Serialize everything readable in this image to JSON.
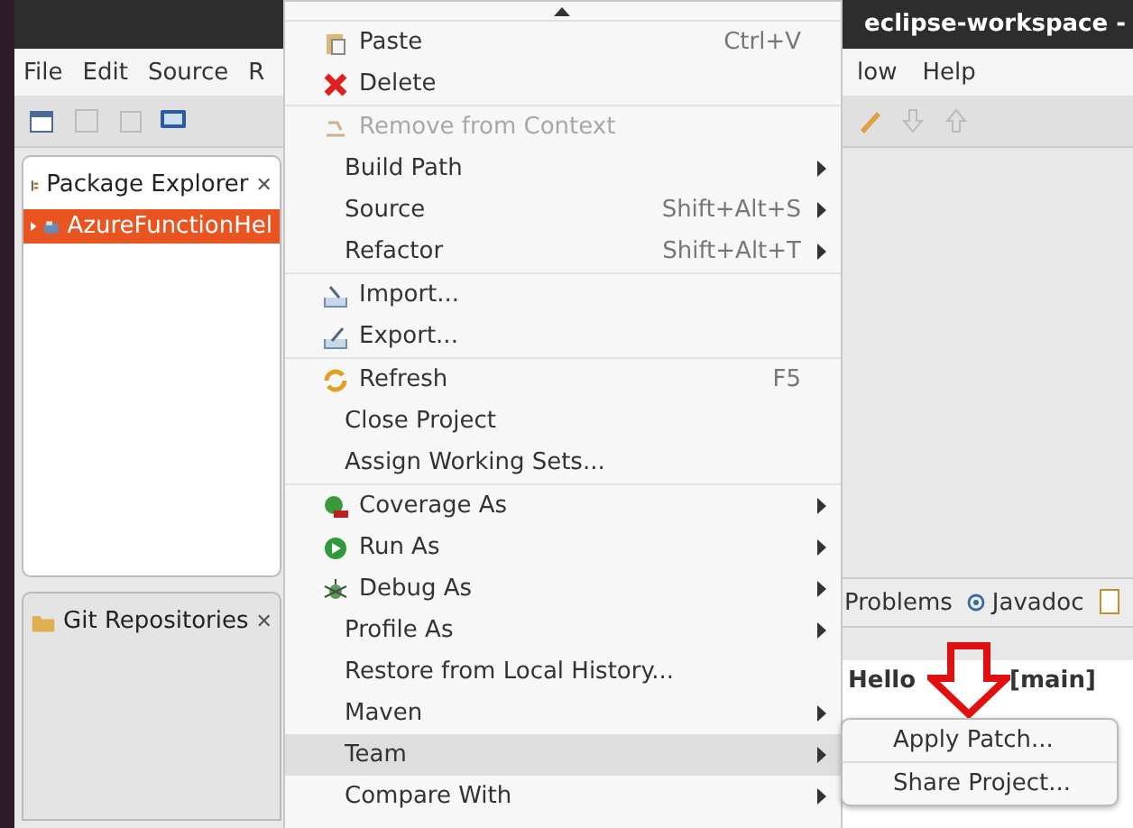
{
  "window": {
    "title": "eclipse-workspace -"
  },
  "menu_bar": {
    "left": [
      "File",
      "Edit",
      "Source",
      "R"
    ],
    "right": [
      "low",
      "Help"
    ]
  },
  "package_explorer": {
    "title": "Package Explorer",
    "close": "✕",
    "tree": [
      {
        "label": "AzureFunctionHel",
        "selected": true,
        "expanded": false
      }
    ]
  },
  "git_repositories": {
    "title": "Git Repositories",
    "close": "✕"
  },
  "bottom_tabs": [
    {
      "label": "Problems"
    },
    {
      "label": "Javadoc"
    }
  ],
  "editor_header": [
    "Hello",
    "[main]"
  ],
  "context_menu": {
    "items": [
      {
        "kind": "item",
        "label": "Paste",
        "shortcut": "Ctrl+V",
        "submenu": false,
        "disabled": false,
        "selected": false
      },
      {
        "kind": "item",
        "label": "Delete",
        "submenu": false,
        "disabled": false,
        "selected": false
      },
      {
        "kind": "separator"
      },
      {
        "kind": "item",
        "label": "Remove from Context",
        "submenu": false,
        "disabled": true,
        "selected": false
      },
      {
        "kind": "item",
        "label": "Build Path",
        "submenu": true,
        "disabled": false,
        "selected": false
      },
      {
        "kind": "item",
        "label": "Source",
        "shortcut": "Shift+Alt+S",
        "submenu": true,
        "disabled": false,
        "selected": false
      },
      {
        "kind": "item",
        "label": "Refactor",
        "shortcut": "Shift+Alt+T",
        "submenu": true,
        "disabled": false,
        "selected": false
      },
      {
        "kind": "separator"
      },
      {
        "kind": "item",
        "label": "Import...",
        "submenu": false,
        "disabled": false,
        "selected": false
      },
      {
        "kind": "item",
        "label": "Export...",
        "submenu": false,
        "disabled": false,
        "selected": false
      },
      {
        "kind": "separator"
      },
      {
        "kind": "item",
        "label": "Refresh",
        "shortcut": "F5",
        "submenu": false,
        "disabled": false,
        "selected": false
      },
      {
        "kind": "item",
        "label": "Close Project",
        "submenu": false,
        "disabled": false,
        "selected": false
      },
      {
        "kind": "item",
        "label": "Assign Working Sets...",
        "submenu": false,
        "disabled": false,
        "selected": false
      },
      {
        "kind": "separator"
      },
      {
        "kind": "item",
        "label": "Coverage As",
        "submenu": true,
        "disabled": false,
        "selected": false
      },
      {
        "kind": "item",
        "label": "Run As",
        "submenu": true,
        "disabled": false,
        "selected": false
      },
      {
        "kind": "item",
        "label": "Debug As",
        "submenu": true,
        "disabled": false,
        "selected": false
      },
      {
        "kind": "item",
        "label": "Profile As",
        "submenu": true,
        "disabled": false,
        "selected": false
      },
      {
        "kind": "item",
        "label": "Restore from Local History...",
        "submenu": false,
        "disabled": false,
        "selected": false
      },
      {
        "kind": "item",
        "label": "Maven",
        "submenu": true,
        "disabled": false,
        "selected": false
      },
      {
        "kind": "item",
        "label": "Team",
        "submenu": true,
        "disabled": false,
        "selected": true
      },
      {
        "kind": "item",
        "label": "Compare With",
        "submenu": true,
        "disabled": false,
        "selected": false
      }
    ]
  },
  "submenu": {
    "items": [
      {
        "label": "Apply Patch..."
      },
      {
        "label": "Share Project..."
      }
    ]
  }
}
